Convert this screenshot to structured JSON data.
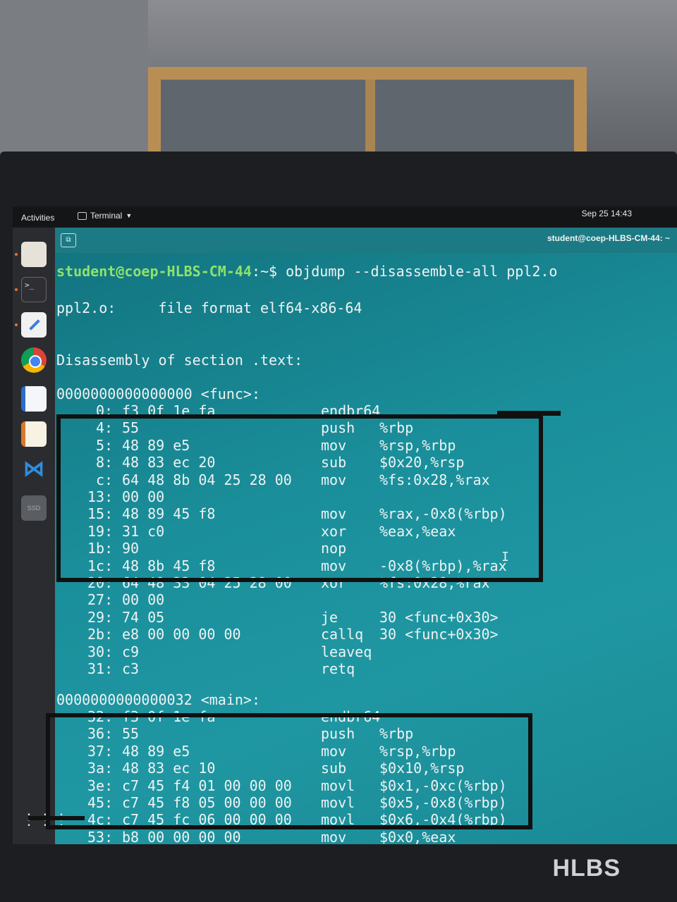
{
  "topbar": {
    "activities": "Activities",
    "app_name": "Terminal",
    "clock": "Sep 25  14:43"
  },
  "dock": {
    "items": [
      "files-icon",
      "terminal-icon",
      "text-editor-icon",
      "chrome-icon",
      "writer-icon",
      "impress-icon",
      "vscode-icon",
      "ssd-icon",
      "show-apps-icon"
    ],
    "terminal_glyph": ">_",
    "vscode_glyph": "⋈",
    "ssd_label": "SSD",
    "apps_glyph": "⋮⋮⋮"
  },
  "terminal_header": {
    "title": "student@coep-HLBS-CM-44: ~",
    "tab_button_glyph": "⧉"
  },
  "terminal": {
    "prompt_user": "student@coep-HLBS-CM-44",
    "prompt_path": ":~$ ",
    "command": "objdump --disassemble-all ppl2.o",
    "file_line": "ppl2.o:     file format elf64-x86-64",
    "section_line": "Disassembly of section .text:",
    "func_header": "0000000000000000 <func>:",
    "func_rows": [
      {
        "addr": "0:",
        "bytes": "f3 0f 1e fa",
        "mnem": "endbr64",
        "ops": ""
      },
      {
        "addr": "4:",
        "bytes": "55",
        "mnem": "push",
        "ops": "%rbp"
      },
      {
        "addr": "5:",
        "bytes": "48 89 e5",
        "mnem": "mov",
        "ops": "%rsp,%rbp"
      },
      {
        "addr": "8:",
        "bytes": "48 83 ec 20",
        "mnem": "sub",
        "ops": "$0x20,%rsp"
      },
      {
        "addr": "c:",
        "bytes": "64 48 8b 04 25 28 00",
        "mnem": "mov",
        "ops": "%fs:0x28,%rax"
      },
      {
        "addr": "13:",
        "bytes": "00 00",
        "mnem": "",
        "ops": ""
      },
      {
        "addr": "15:",
        "bytes": "48 89 45 f8",
        "mnem": "mov",
        "ops": "%rax,-0x8(%rbp)"
      },
      {
        "addr": "19:",
        "bytes": "31 c0",
        "mnem": "xor",
        "ops": "%eax,%eax"
      },
      {
        "addr": "1b:",
        "bytes": "90",
        "mnem": "nop",
        "ops": ""
      },
      {
        "addr": "1c:",
        "bytes": "48 8b 45 f8",
        "mnem": "mov",
        "ops": "-0x8(%rbp),%rax"
      },
      {
        "addr": "20:",
        "bytes": "64 48 33 04 25 28 00",
        "mnem": "xor",
        "ops": "%fs:0x28,%rax"
      },
      {
        "addr": "27:",
        "bytes": "00 00",
        "mnem": "",
        "ops": ""
      },
      {
        "addr": "29:",
        "bytes": "74 05",
        "mnem": "je",
        "ops": "30 <func+0x30>"
      },
      {
        "addr": "2b:",
        "bytes": "e8 00 00 00 00",
        "mnem": "callq",
        "ops": "30 <func+0x30>"
      },
      {
        "addr": "30:",
        "bytes": "c9",
        "mnem": "leaveq",
        "ops": ""
      },
      {
        "addr": "31:",
        "bytes": "c3",
        "mnem": "retq",
        "ops": ""
      }
    ],
    "main_header": "0000000000000032 <main>:",
    "main_rows": [
      {
        "addr": "32:",
        "bytes": "f3 0f 1e fa",
        "mnem": "endbr64",
        "ops": ""
      },
      {
        "addr": "36:",
        "bytes": "55",
        "mnem": "push",
        "ops": "%rbp"
      },
      {
        "addr": "37:",
        "bytes": "48 89 e5",
        "mnem": "mov",
        "ops": "%rsp,%rbp"
      },
      {
        "addr": "3a:",
        "bytes": "48 83 ec 10",
        "mnem": "sub",
        "ops": "$0x10,%rsp"
      },
      {
        "addr": "3e:",
        "bytes": "c7 45 f4 01 00 00 00",
        "mnem": "movl",
        "ops": "$0x1,-0xc(%rbp)"
      },
      {
        "addr": "45:",
        "bytes": "c7 45 f8 05 00 00 00",
        "mnem": "movl",
        "ops": "$0x5,-0x8(%rbp)"
      },
      {
        "addr": "4c:",
        "bytes": "c7 45 fc 06 00 00 00",
        "mnem": "movl",
        "ops": "$0x6,-0x4(%rbp)"
      },
      {
        "addr": "53:",
        "bytes": "b8 00 00 00 00",
        "mnem": "mov",
        "ops": "$0x0,%eax"
      }
    ],
    "cursor_glyph": "I"
  },
  "monitor": {
    "brand": "HLBS"
  }
}
